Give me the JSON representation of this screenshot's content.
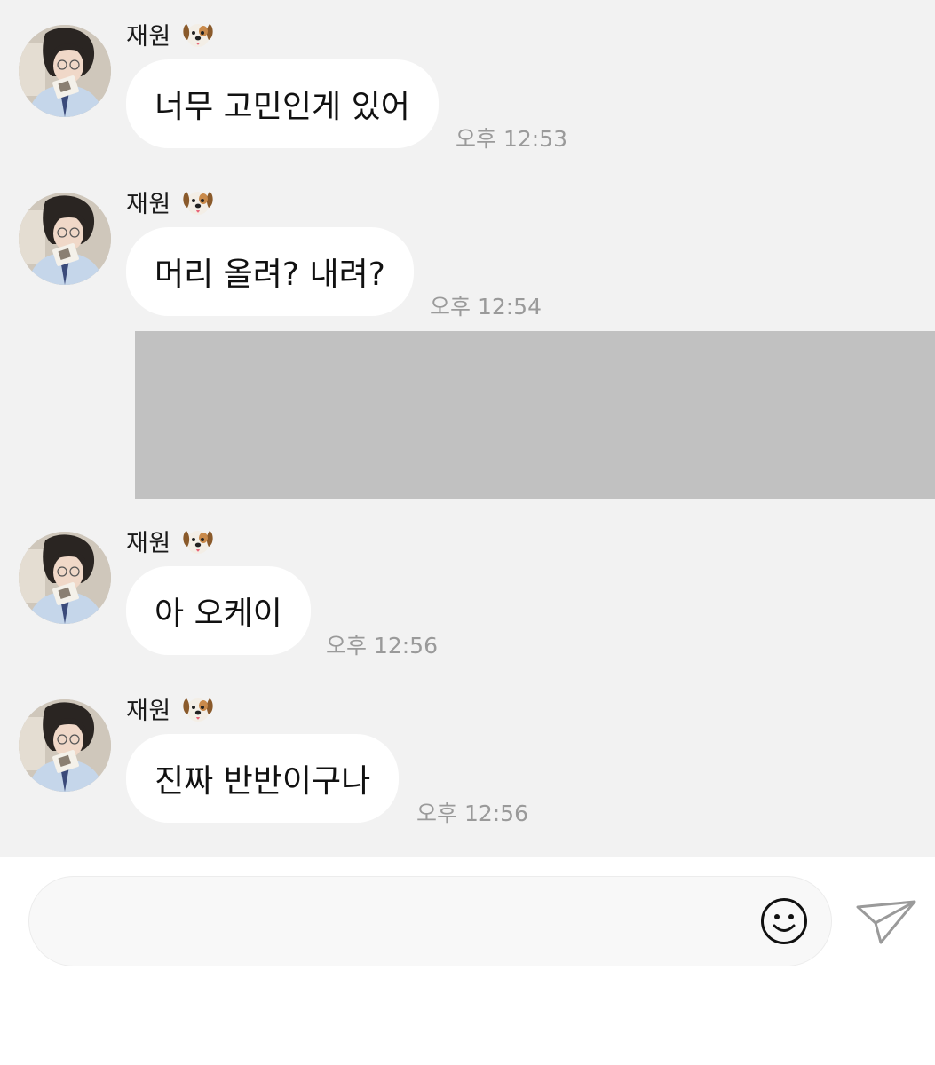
{
  "messages": [
    {
      "sender": "재원",
      "sender_icon": "dog-face-icon",
      "text": "너무 고민인게 있어",
      "time": "오후 12:53"
    },
    {
      "sender": "재원",
      "sender_icon": "dog-face-icon",
      "text": "머리 올려? 내려?",
      "time": "오후 12:54"
    },
    {
      "sender": "재원",
      "sender_icon": "dog-face-icon",
      "text": "아 오케이",
      "time": "오후 12:56"
    },
    {
      "sender": "재원",
      "sender_icon": "dog-face-icon",
      "text": "진짜 반반이구나",
      "time": "오후 12:56"
    }
  ],
  "composer": {
    "placeholder": "",
    "emoji_icon": "smiley-icon",
    "send_icon": "paper-plane-icon"
  },
  "colors": {
    "chat_background": "#f2f2f2",
    "bubble": "#ffffff",
    "timestamp": "#9a9a9a",
    "redacted_block": "#c1c1c1"
  }
}
